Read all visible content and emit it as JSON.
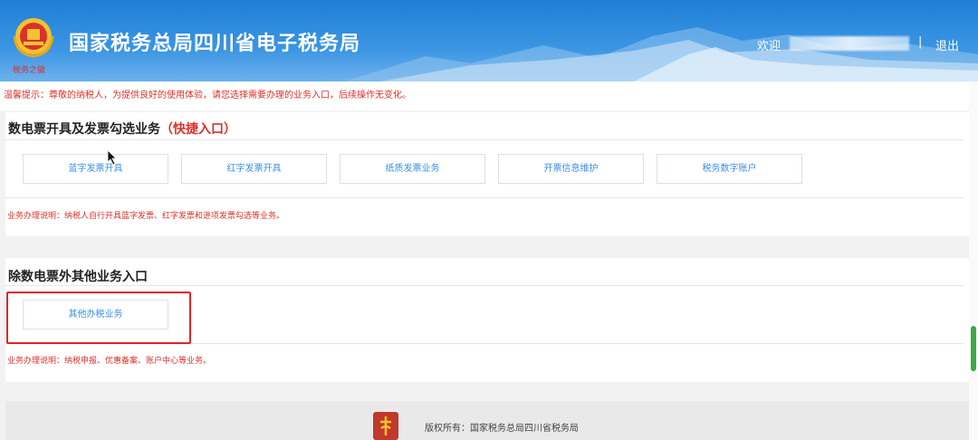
{
  "header": {
    "title": "国家税务总局四川省电子税务局",
    "welcome": "欢迎",
    "separator": "|",
    "logout": "退出"
  },
  "notice": "温馨提示：尊敬的纳税人，为提供良好的使用体验，请您选择需要办理的业务入口，后续操作无变化。",
  "section1": {
    "title": "数电票开具及发票勾选业务",
    "highlight": "（快捷入口）",
    "buttons": [
      "蓝字发票开具",
      "红字发票开具",
      "纸质发票业务",
      "开票信息维护",
      "税务数字账户"
    ],
    "description": "业务办理说明：纳税人自行开具蓝字发票、红字发票和进项发票勾选等业务。"
  },
  "section2": {
    "title": "除数电票外其他业务入口",
    "buttons": [
      "其他办税业务"
    ],
    "description": "业务办理说明：纳税申报、优惠备案、账户中心等业务。"
  },
  "footer": {
    "copyright": "版权所有：国家税务总局四川省税务局"
  },
  "colors": {
    "header_blue": "#1f7fd6",
    "alert_red": "#d9312b",
    "link_blue": "#3a8ee6",
    "highlight_box": "#e02424"
  }
}
